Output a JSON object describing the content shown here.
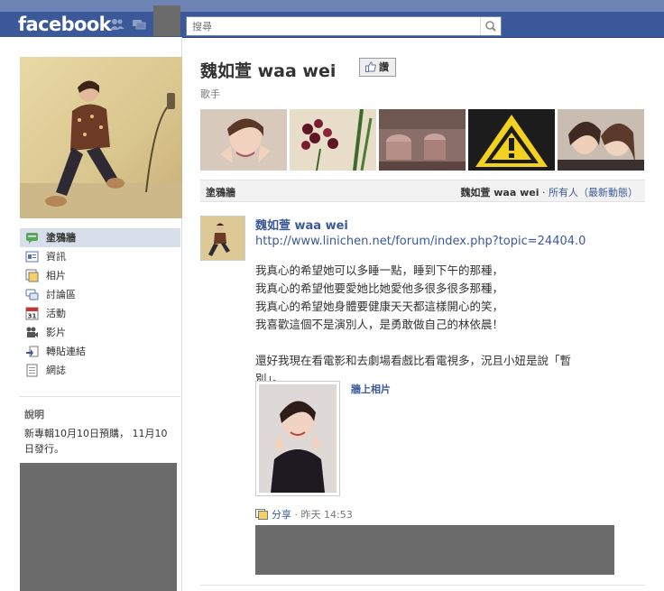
{
  "topbar": {
    "logo": "facebook",
    "search_placeholder": "搜尋",
    "icons": [
      "friends-icon",
      "messages-icon",
      "search-icon"
    ],
    "color": "#3b5998"
  },
  "sidebar": {
    "items": [
      {
        "label": "塗鴉牆",
        "icon": "wall-icon",
        "active": true
      },
      {
        "label": "資訊",
        "icon": "info-icon"
      },
      {
        "label": "相片",
        "icon": "photos-icon"
      },
      {
        "label": "討論區",
        "icon": "discussion-icon"
      },
      {
        "label": "活動",
        "icon": "events-calendar-icon",
        "icon_text": "31"
      },
      {
        "label": "影片",
        "icon": "video-icon"
      },
      {
        "label": "轉貼連結",
        "icon": "links-icon"
      },
      {
        "label": "網誌",
        "icon": "notes-icon"
      }
    ],
    "about_heading": "說明",
    "about_text": "新專輯10月10日預購， 11月10日發行。"
  },
  "page": {
    "title": "魏如萱 waa wei",
    "like_label": "讚",
    "category": "歌手"
  },
  "wall": {
    "tab": "塗鴉牆",
    "filter_name": "魏如萱 waa wei",
    "filter_sep": " · ",
    "filter_link": "所有人（最新動態）"
  },
  "post": {
    "author": "魏如萱 waa wei",
    "link": "http://www.linichen.net/forum/index.php?topic=24404.0",
    "lines": [
      "我真心的希望她可以多睡一點，睡到下午的那種，",
      "我真心的希望他要愛她比她愛他多很多很多那種，",
      "我真心的希望她身體要健康天天都這樣開心的笑，",
      "我喜歡這個不是演別人，是勇敢做自己的林依晨！",
      "",
      "還好我現在看電影和去劇場看戲比看電視多，況且小妞是說「暫",
      "別」。"
    ],
    "attachment_title": "牆上相片",
    "meta_share": "分享",
    "meta_sep": " · ",
    "meta_time": "昨天 14:53"
  },
  "colors": {
    "brand": "#3b5998",
    "link": "#3b5998",
    "redacted": "#6b6b6b"
  }
}
